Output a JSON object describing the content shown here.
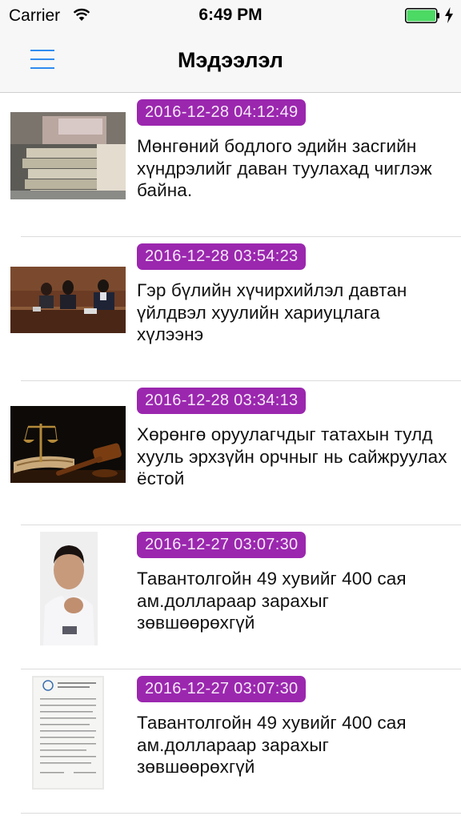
{
  "status_bar": {
    "carrier": "Carrier",
    "time": "6:49 PM",
    "battery_color": "#4cd964"
  },
  "nav": {
    "title": "Мэдээлэл",
    "menu_icon": "hamburger-icon",
    "accent_color": "#007aff"
  },
  "badge_color": "#9b27af",
  "news": [
    {
      "date": "2016-12-28 04:12:49",
      "title": "Мөнгөний бодлого эдийн засгийн хүндрэлийг даван туулахад чиглэж байна.",
      "image": "money-stack-photo"
    },
    {
      "date": "2016-12-28 03:54:23",
      "title": "Гэр бүлийн хүчирхийлэл давтан үйлдвэл хуулийн хариуцлага хүлээнэ",
      "image": "parliament-meeting-photo"
    },
    {
      "date": "2016-12-28 03:34:13",
      "title": "Хөрөнгө оруулагчдыг татахын тулд хууль эрхзүйн орчныг нь сайжруулах ёстой",
      "image": "gavel-scales-photo"
    },
    {
      "date": "2016-12-27 03:07:30",
      "title": "Тавантолгойн 49 хувийг 400 сая ам.доллараар зарахыг зөвшөөрөхгүй",
      "image": "portrait-photo"
    },
    {
      "date": "2016-12-27 03:07:30",
      "title": "Тавантолгойн 49 хувийг 400 сая ам.доллараар зарахыг зөвшөөрөхгүй",
      "image": "document-photo"
    }
  ]
}
